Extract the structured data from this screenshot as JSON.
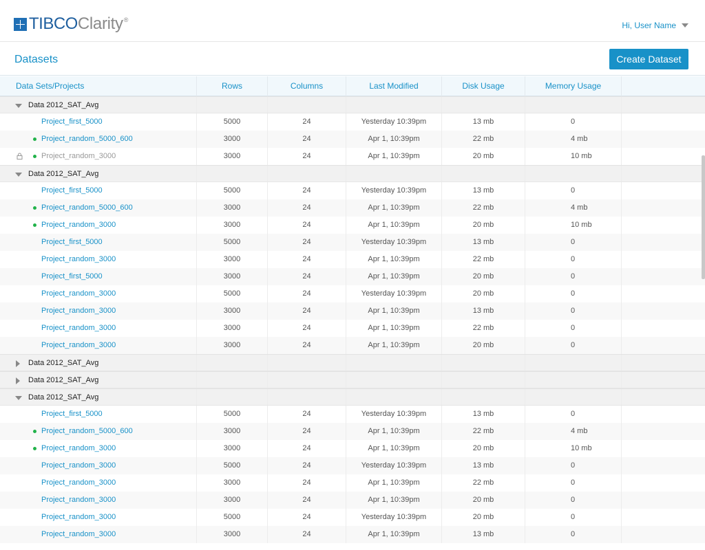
{
  "app": {
    "logo_primary": "TIBCO",
    "logo_secondary": "Clarity",
    "logo_reg": "®"
  },
  "user": {
    "greeting": "Hi, User Name"
  },
  "page": {
    "title": "Datasets",
    "create_button": "Create Dataset"
  },
  "table": {
    "columns": [
      "Data Sets/Projects",
      "Rows",
      "Columns",
      "Last Modified",
      "Disk Usage",
      "Memory Usage"
    ],
    "groups": [
      {
        "name": "Data 2012_SAT_Avg",
        "expanded": true,
        "projects": [
          {
            "name": "Project_first_5000",
            "rows": "5000",
            "columns": "24",
            "modified": "Yesterday 10:39pm",
            "disk": "13 mb",
            "memory": "0",
            "status": "none"
          },
          {
            "name": "Project_random_5000_600",
            "rows": "3000",
            "columns": "24",
            "modified": "Apr 1, 10:39pm",
            "disk": "22 mb",
            "memory": "4 mb",
            "status": "active"
          },
          {
            "name": "Project_random_3000",
            "rows": "3000",
            "columns": "24",
            "modified": "Apr 1, 10:39pm",
            "disk": "20 mb",
            "memory": "10 mb",
            "status": "locked"
          }
        ]
      },
      {
        "name": "Data 2012_SAT_Avg",
        "expanded": true,
        "projects": [
          {
            "name": "Project_first_5000",
            "rows": "5000",
            "columns": "24",
            "modified": "Yesterday 10:39pm",
            "disk": "13 mb",
            "memory": "0",
            "status": "none"
          },
          {
            "name": "Project_random_5000_600",
            "rows": "3000",
            "columns": "24",
            "modified": "Apr 1, 10:39pm",
            "disk": "22 mb",
            "memory": "4 mb",
            "status": "active"
          },
          {
            "name": "Project_random_3000",
            "rows": "3000",
            "columns": "24",
            "modified": "Apr 1, 10:39pm",
            "disk": "20 mb",
            "memory": "10 mb",
            "status": "active"
          },
          {
            "name": "Project_first_5000",
            "rows": "5000",
            "columns": "24",
            "modified": "Yesterday 10:39pm",
            "disk": "13 mb",
            "memory": "0",
            "status": "none"
          },
          {
            "name": "Project_random_3000",
            "rows": "3000",
            "columns": "24",
            "modified": "Apr 1, 10:39pm",
            "disk": "22 mb",
            "memory": "0",
            "status": "none"
          },
          {
            "name": "Project_first_5000",
            "rows": "3000",
            "columns": "24",
            "modified": "Apr 1, 10:39pm",
            "disk": "20 mb",
            "memory": "0",
            "status": "none"
          },
          {
            "name": "Project_random_3000",
            "rows": "5000",
            "columns": "24",
            "modified": "Yesterday 10:39pm",
            "disk": "20 mb",
            "memory": "0",
            "status": "none"
          },
          {
            "name": "Project_random_3000",
            "rows": "3000",
            "columns": "24",
            "modified": "Apr 1, 10:39pm",
            "disk": "13 mb",
            "memory": "0",
            "status": "none"
          },
          {
            "name": "Project_random_3000",
            "rows": "3000",
            "columns": "24",
            "modified": "Apr 1, 10:39pm",
            "disk": "22 mb",
            "memory": "0",
            "status": "none"
          },
          {
            "name": "Project_random_3000",
            "rows": "3000",
            "columns": "24",
            "modified": "Apr 1, 10:39pm",
            "disk": "20 mb",
            "memory": "0",
            "status": "none"
          }
        ]
      },
      {
        "name": "Data 2012_SAT_Avg",
        "expanded": false,
        "projects": []
      },
      {
        "name": "Data 2012_SAT_Avg",
        "expanded": false,
        "projects": []
      },
      {
        "name": "Data 2012_SAT_Avg",
        "expanded": true,
        "projects": [
          {
            "name": "Project_first_5000",
            "rows": "5000",
            "columns": "24",
            "modified": "Yesterday 10:39pm",
            "disk": "13 mb",
            "memory": "0",
            "status": "none"
          },
          {
            "name": "Project_random_5000_600",
            "rows": "3000",
            "columns": "24",
            "modified": "Apr 1, 10:39pm",
            "disk": "22 mb",
            "memory": "4 mb",
            "status": "active"
          },
          {
            "name": "Project_random_3000",
            "rows": "3000",
            "columns": "24",
            "modified": "Apr 1, 10:39pm",
            "disk": "20 mb",
            "memory": "10 mb",
            "status": "active"
          },
          {
            "name": "Project_random_3000",
            "rows": "5000",
            "columns": "24",
            "modified": "Yesterday 10:39pm",
            "disk": "13 mb",
            "memory": "0",
            "status": "none"
          },
          {
            "name": "Project_random_3000",
            "rows": "3000",
            "columns": "24",
            "modified": "Apr 1, 10:39pm",
            "disk": "22 mb",
            "memory": "0",
            "status": "none"
          },
          {
            "name": "Project_random_3000",
            "rows": "3000",
            "columns": "24",
            "modified": "Apr 1, 10:39pm",
            "disk": "20 mb",
            "memory": "0",
            "status": "none"
          },
          {
            "name": "Project_random_3000",
            "rows": "5000",
            "columns": "24",
            "modified": "Yesterday 10:39pm",
            "disk": "20 mb",
            "memory": "0",
            "status": "none"
          },
          {
            "name": "Project_random_3000",
            "rows": "3000",
            "columns": "24",
            "modified": "Apr 1, 10:39pm",
            "disk": "13 mb",
            "memory": "0",
            "status": "none"
          }
        ]
      }
    ]
  },
  "colors": {
    "brand_blue": "#1891c8",
    "logo_blue": "#1f5f9f",
    "status_green": "#21b24a"
  }
}
